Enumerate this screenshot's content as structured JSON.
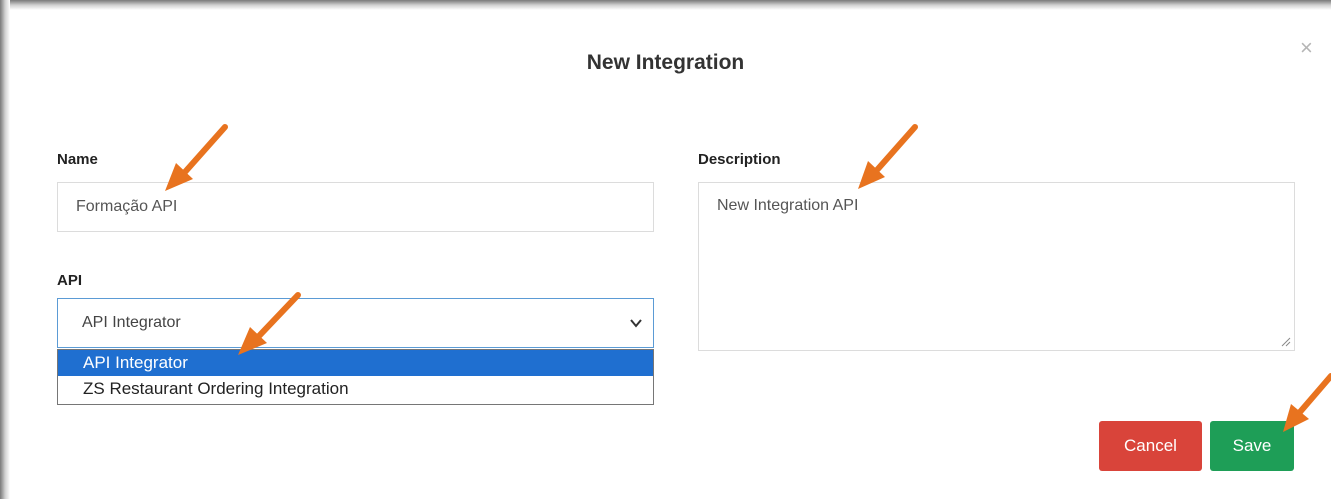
{
  "dialog": {
    "title": "New Integration",
    "close_symbol": "×"
  },
  "form": {
    "name": {
      "label": "Name",
      "value": "Formação API"
    },
    "api": {
      "label": "API",
      "selected": "API Integrator",
      "options": [
        "API Integrator",
        "ZS Restaurant Ordering Integration"
      ]
    },
    "description": {
      "label": "Description",
      "value": "New Integration API"
    }
  },
  "buttons": {
    "cancel": "Cancel",
    "save": "Save"
  },
  "colors": {
    "cancel": "#d9443a",
    "save": "#1e9e57",
    "selected_option": "#1f6fd0",
    "annotation_arrow": "#e8731f"
  },
  "icons": {
    "close": "close-icon",
    "select_chevron": "chevron-down-icon",
    "resize_grip": "resize-grip-icon",
    "annotation": "arrow-annotation-icon"
  }
}
